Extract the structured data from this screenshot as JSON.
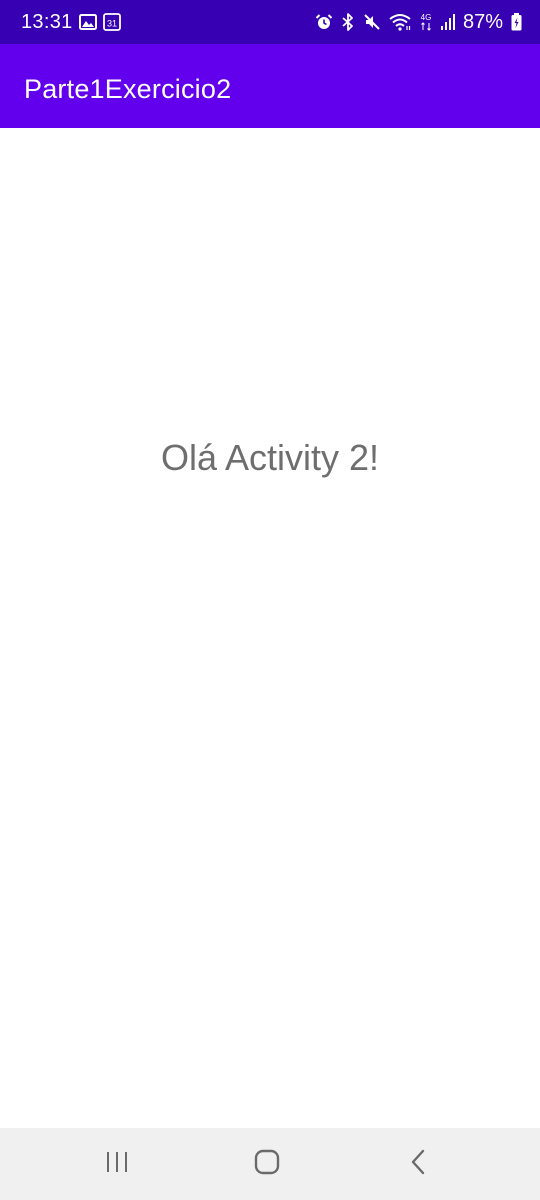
{
  "status_bar": {
    "time": "13:31",
    "battery": "87%",
    "background": "#3700b3",
    "icons_left": [
      "gallery-icon",
      "calendar-icon"
    ],
    "calendar_day": "31",
    "icons_right": [
      "alarm-icon",
      "bluetooth-icon",
      "mute-icon",
      "wifi-icon",
      "network-4g-icon",
      "signal-icon",
      "battery-icon"
    ],
    "network_label": "4G"
  },
  "app_bar": {
    "title": "Parte1Exercicio2",
    "background": "#6200ee"
  },
  "content": {
    "message": "Olá Activity 2!",
    "text_color": "#6e6e6e"
  },
  "nav_bar": {
    "background": "#f0f0f0",
    "buttons": [
      "recents-icon",
      "home-icon",
      "back-icon"
    ]
  }
}
